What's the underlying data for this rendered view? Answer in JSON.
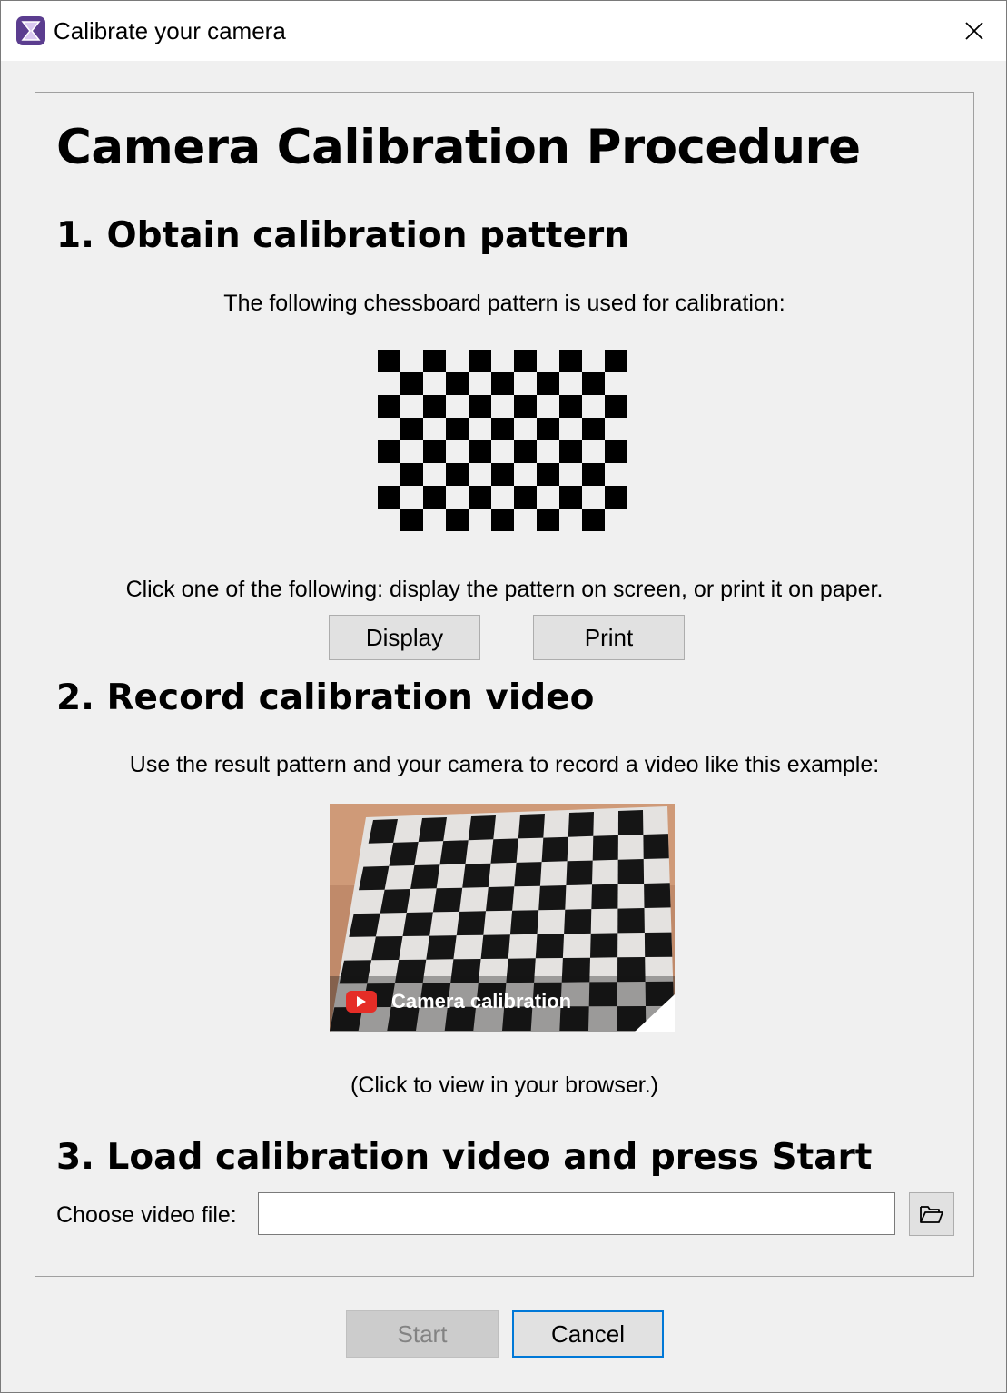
{
  "window": {
    "title": "Calibrate your camera",
    "app_icon": "hourglass-logo-icon",
    "close_icon": "close-icon"
  },
  "heading": "Camera Calibration Procedure",
  "step1": {
    "title": "1. Obtain calibration pattern",
    "description": "The following chessboard pattern is used for calibration:",
    "instruction": "Click one of the following: display the pattern on screen, or print it on paper.",
    "display_label": "Display",
    "print_label": "Print"
  },
  "step2": {
    "title": "2. Record calibration video",
    "description": "Use the result pattern and your camera to record a video like this example:",
    "video_caption": "Camera calibration",
    "hint": "(Click to view in your browser.)"
  },
  "step3": {
    "title": "3. Load calibration video and press Start",
    "file_label": "Choose video file:",
    "file_value": "",
    "browse_icon": "folder-open-icon"
  },
  "footer": {
    "start_label": "Start",
    "cancel_label": "Cancel"
  },
  "colors": {
    "window_bg": "#f0f0f0",
    "accent": "#0078d7",
    "youtube_red": "#e52d27"
  }
}
